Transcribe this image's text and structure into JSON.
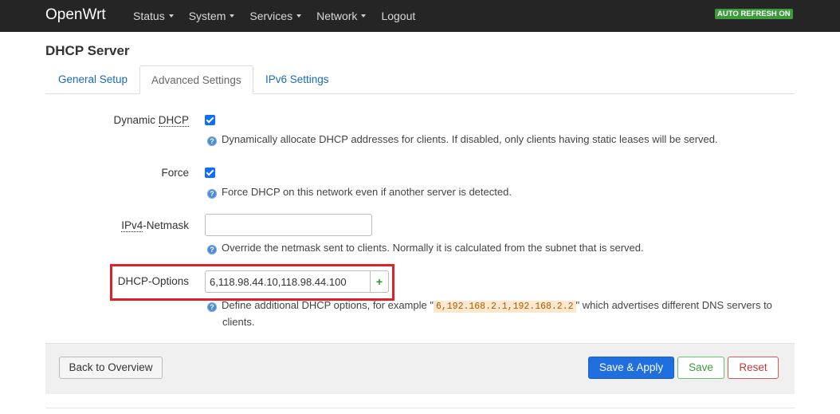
{
  "header": {
    "brand": "OpenWrt",
    "nav": [
      "Status",
      "System",
      "Services",
      "Network",
      "Logout"
    ],
    "auto_refresh": "AUTO REFRESH ON"
  },
  "page": {
    "title": "DHCP Server",
    "tabs": [
      "General Setup",
      "Advanced Settings",
      "IPv6 Settings"
    ],
    "active_tab": "Advanced Settings"
  },
  "fields": {
    "dynamic_dhcp": {
      "label_prefix": "Dynamic ",
      "label_abbr": "DHCP",
      "checked": true,
      "help": "Dynamically allocate DHCP addresses for clients. If disabled, only clients having static leases will be served."
    },
    "force": {
      "label": "Force",
      "checked": true,
      "help": "Force DHCP on this network even if another server is detected."
    },
    "netmask": {
      "label_abbr": "IPv4",
      "label_suffix": "-Netmask",
      "value": "",
      "help": "Override the netmask sent to clients. Normally it is calculated from the subnet that is served."
    },
    "dhcp_options": {
      "label": "DHCP-Options",
      "value": "6,118.98.44.10,118.98.44.100",
      "add_symbol": "+",
      "help_before": "Define additional DHCP options, for example \"",
      "help_code": "6,192.168.2.1,192.168.2.2",
      "help_after": "\" which advertises different DNS servers to",
      "help_wrap": "clients."
    }
  },
  "footer": {
    "back": "Back to Overview",
    "save_apply": "Save & Apply",
    "save": "Save",
    "reset": "Reset"
  }
}
